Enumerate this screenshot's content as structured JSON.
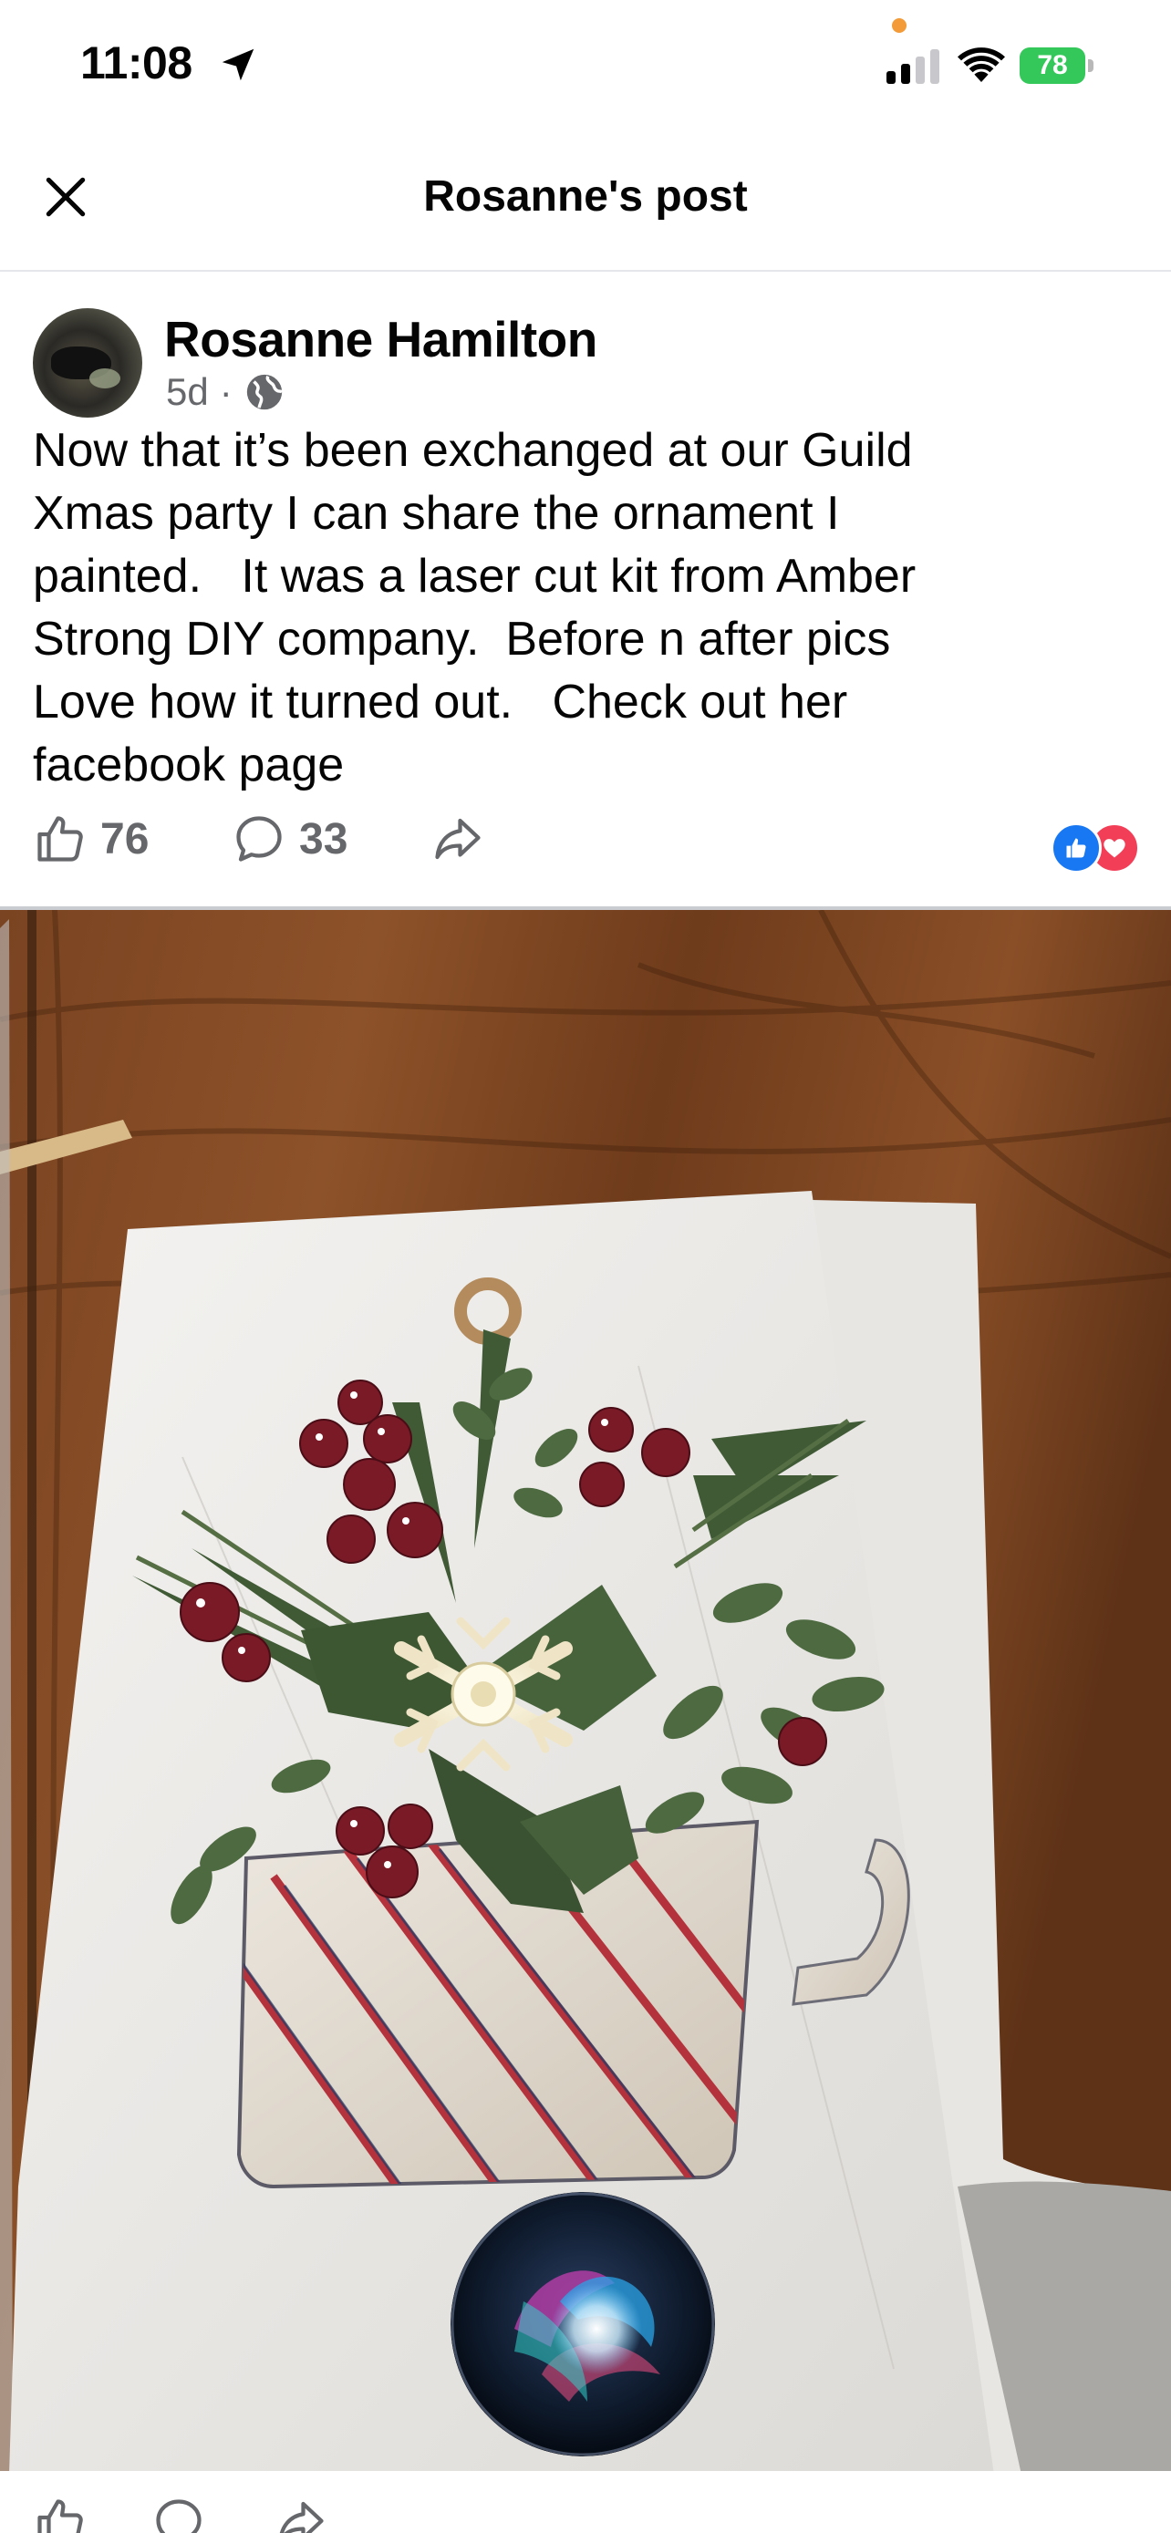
{
  "status_bar": {
    "time": "11:08",
    "battery": "78",
    "icons": [
      "location-arrow-icon",
      "signal-icon",
      "wifi-icon",
      "battery-charging-icon"
    ],
    "colors": {
      "battery": "#34c759",
      "recording_dot": "#f29b38"
    }
  },
  "header": {
    "title": "Rosanne's post",
    "close_icon": "close-icon"
  },
  "post": {
    "author": "Rosanne Hamilton",
    "time_ago": "5d",
    "separator": "·",
    "audience_icon": "globe-icon",
    "text": "Now that it’s been exchanged at our Guild\nXmas party I can share the ornament I\npainted.   It was a laser cut kit from Amber\nStrong DIY company.  Before n after pics\nLove how it turned out.   Check out her\nfacebook page",
    "likes": "76",
    "comments": "33",
    "reaction_types": [
      "like",
      "love"
    ],
    "colors": {
      "like": "#1877f2",
      "love": "#f33e58",
      "secondary_text": "#65676b"
    }
  },
  "photo": {
    "subject": "painted ornament"
  },
  "overlay": {
    "assistant_icon": "siri-orb-icon"
  },
  "bottom_bar": {
    "icons": [
      "like-icon",
      "comment-icon",
      "share-icon"
    ]
  }
}
